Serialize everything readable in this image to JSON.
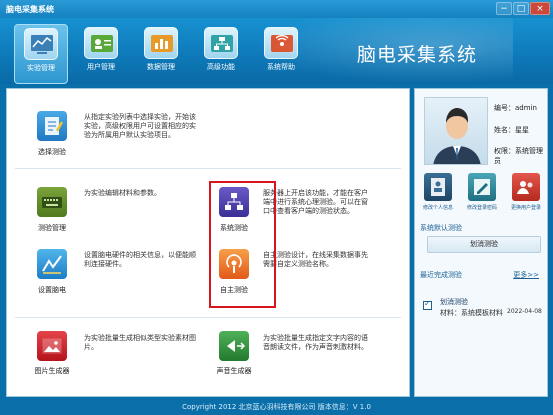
{
  "window": {
    "title": "脑电采集系统",
    "controls": [
      "−",
      "□",
      "×"
    ]
  },
  "header": {
    "brand": "脑电采集系统",
    "nav": [
      {
        "label": "实验管理",
        "icon": "chart-monitor-icon",
        "active": true
      },
      {
        "label": "用户管理",
        "icon": "user-card-icon",
        "active": false
      },
      {
        "label": "数据管理",
        "icon": "bar-chart-icon",
        "active": false
      },
      {
        "label": "高级功能",
        "icon": "network-icon",
        "active": false
      },
      {
        "label": "系统帮助",
        "icon": "help-broadcast-icon",
        "active": false
      }
    ]
  },
  "features": {
    "select": {
      "name": "选择测验",
      "icon": "select-pen-icon",
      "desc": "从指定实验列表中选择实验，开始该实验，高级权限用户可设置相应的实验为所属用户默认实验项目。"
    },
    "manage": {
      "name": "测验管理",
      "icon": "keyboard-icon",
      "desc": "为实验编辑材料和参数。"
    },
    "eeg_setup": {
      "name": "设置脑电",
      "icon": "eeg-chart-icon",
      "desc": "设置脑电硬件的相关信息，以便能顺利连接硬件。"
    },
    "system_test": {
      "name": "系统测验",
      "icon": "network-tree-icon",
      "desc": "服务器上开启该功能，才能在客户端中进行系统心理测验。可以在窗口中查看客户端的测验状态。"
    },
    "custom_test": {
      "name": "自主测验",
      "icon": "podcast-icon",
      "desc": "自主测验设计，在线采集数据事先需要自定义测验名称。"
    },
    "image_gen": {
      "name": "图片生成器",
      "icon": "picture-icon",
      "desc": "为实验批量生成相似类型实验素材图片。"
    },
    "sound_gen": {
      "name": "声音生成器",
      "icon": "sound-export-icon",
      "desc": "为实验批量生成指定文字内容的语音朗读文件，作为声音刺激材料。"
    }
  },
  "user": {
    "id_label": "编号：",
    "id_value": "admin",
    "name_label": "姓名：",
    "name_value": "星星",
    "role_label": "权限：",
    "role_value": "系统管理员",
    "actions": [
      {
        "label": "修改个人信息",
        "icon": "address-book-icon"
      },
      {
        "label": "修改登录密码",
        "icon": "edit-password-icon"
      },
      {
        "label": "更换用户登录",
        "icon": "switch-user-icon"
      }
    ]
  },
  "default_experiment": {
    "title": "系统默认测验",
    "value": "划消测验"
  },
  "recent": {
    "title": "最近完成测验",
    "more": "更多>>",
    "items": [
      {
        "name": "划消测验",
        "material_label": "材料：",
        "material": "系统模板材料",
        "date": "2022-04-08"
      }
    ]
  },
  "footer": {
    "text": "Copyright 2012 北京蓝心羽科技有限公司 版本信息：V 1.0"
  },
  "colors": {
    "header_blue": "#1581bf",
    "highlight_red": "#d8141c",
    "link_blue": "#1b5f94"
  }
}
